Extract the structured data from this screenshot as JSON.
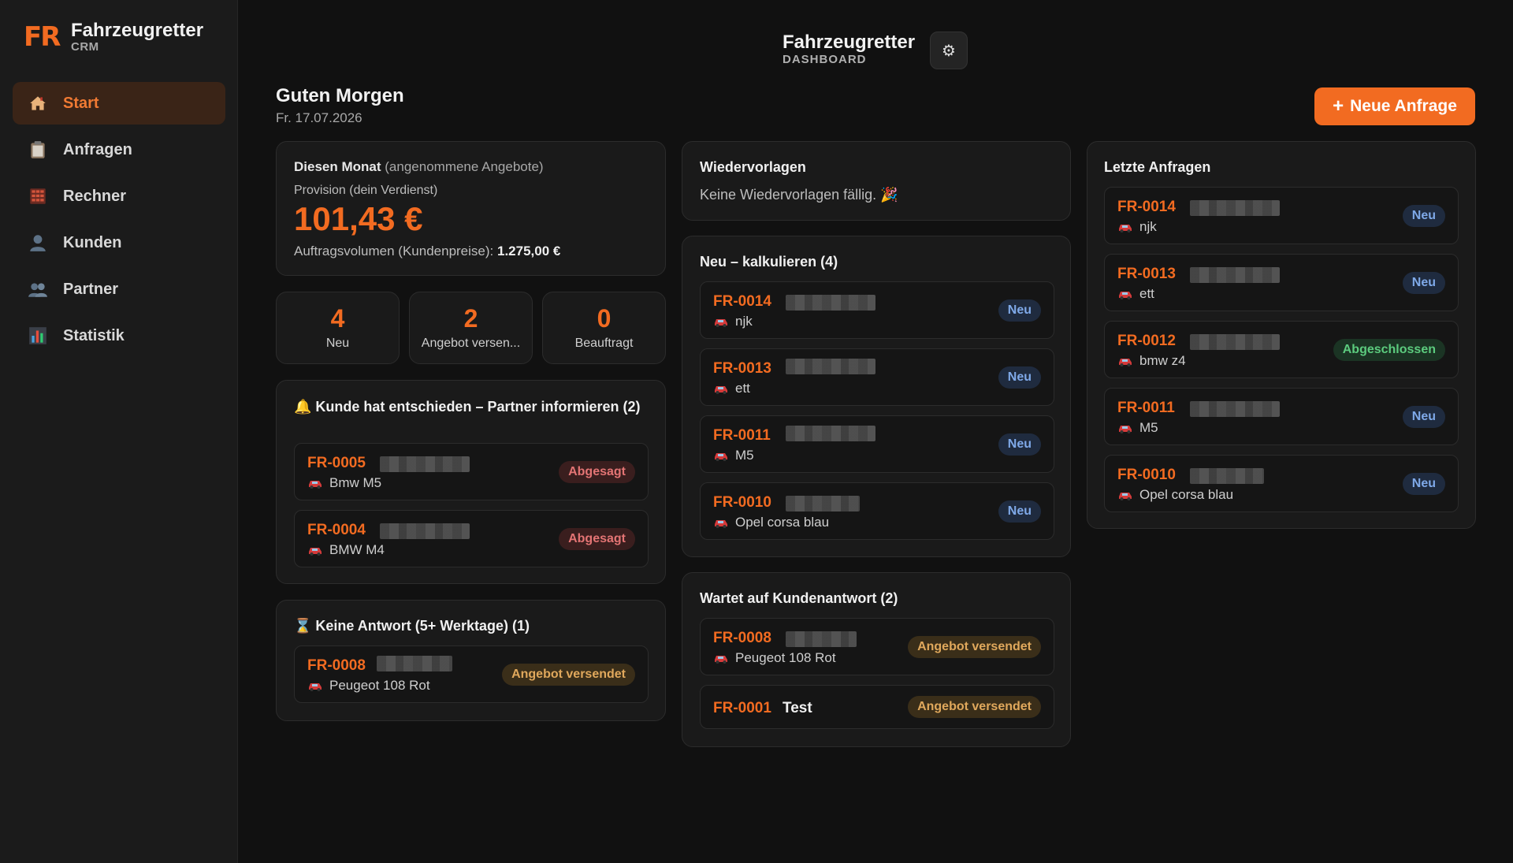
{
  "brand": {
    "logo": "FR",
    "title": "Fahrzeugretter",
    "subtitle": "CRM"
  },
  "sidebar": {
    "items": [
      {
        "label": "Start",
        "icon": "home-icon",
        "active": true
      },
      {
        "label": "Anfragen",
        "icon": "clipboard-icon"
      },
      {
        "label": "Rechner",
        "icon": "calculator-icon"
      },
      {
        "label": "Kunden",
        "icon": "user-icon"
      },
      {
        "label": "Partner",
        "icon": "users-icon"
      },
      {
        "label": "Statistik",
        "icon": "chart-icon"
      }
    ]
  },
  "header": {
    "title": "Fahrzeugretter",
    "subtitle": "DASHBOARD",
    "settings_icon": "gear-icon"
  },
  "greeting": {
    "title": "Guten Morgen",
    "date": "Fr. 17.07.2026"
  },
  "new_request_button": {
    "label": "Neue Anfrage",
    "icon": "plus-icon"
  },
  "month": {
    "title": "Diesen Monat",
    "title_note": "(angenommene Angebote)",
    "commission_label": "Provision (dein Verdienst)",
    "commission_value": "101,43 €",
    "volume_label": "Auftragsvolumen (Kundenpreise):",
    "volume_value": "1.275,00 €"
  },
  "stats": [
    {
      "value": "4",
      "label": "Neu"
    },
    {
      "value": "2",
      "label": "Angebot versen..."
    },
    {
      "value": "0",
      "label": "Beauftragt"
    }
  ],
  "decided": {
    "title": "🔔 Kunde hat entschieden – Partner informieren (2)",
    "rows": [
      {
        "id": "FR-0005",
        "car": "Bmw M5",
        "status": "Abgesagt"
      },
      {
        "id": "FR-0004",
        "car": "BMW M4",
        "status": "Abgesagt"
      }
    ]
  },
  "no_answer": {
    "title": "⌛ Keine Antwort (5+ Werktage) (1)",
    "rows": [
      {
        "id": "FR-0008",
        "car": "Peugeot 108 Rot",
        "status": "Angebot versendet"
      }
    ]
  },
  "followups": {
    "title": "Wiedervorlagen",
    "empty_text": "Keine Wiedervorlagen fällig. 🎉"
  },
  "calculate": {
    "title": "Neu – kalkulieren (4)",
    "rows": [
      {
        "id": "FR-0014",
        "car": "njk",
        "status": "Neu"
      },
      {
        "id": "FR-0013",
        "car": "ett",
        "status": "Neu"
      },
      {
        "id": "FR-0011",
        "car": "M5",
        "status": "Neu"
      },
      {
        "id": "FR-0010",
        "car": "Opel corsa blau",
        "status": "Neu"
      }
    ]
  },
  "waiting": {
    "title": "Wartet auf Kundenantwort (2)",
    "rows": [
      {
        "id": "FR-0008",
        "car": "Peugeot 108 Rot",
        "status": "Angebot versendet"
      },
      {
        "id": "FR-0001",
        "name": "Test",
        "status": "Angebot versendet"
      }
    ]
  },
  "recent": {
    "title": "Letzte Anfragen",
    "rows": [
      {
        "id": "FR-0014",
        "car": "njk",
        "status": "Neu"
      },
      {
        "id": "FR-0013",
        "car": "ett",
        "status": "Neu"
      },
      {
        "id": "FR-0012",
        "car": "bmw z4",
        "status": "Abgeschlossen"
      },
      {
        "id": "FR-0011",
        "car": "M5",
        "status": "Neu"
      },
      {
        "id": "FR-0010",
        "car": "Opel corsa blau",
        "status": "Neu"
      }
    ]
  },
  "colors": {
    "accent": "#f26b21",
    "background": "#111111",
    "sidebar": "#1b1b1b"
  }
}
